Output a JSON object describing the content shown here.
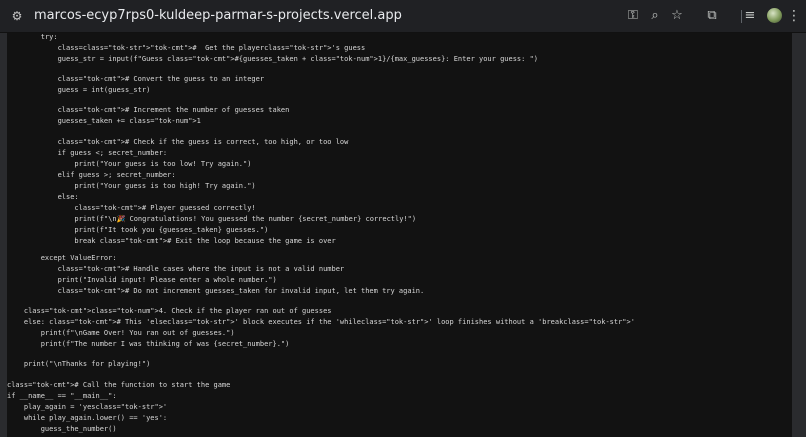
{
  "browser": {
    "url": "marcos-ecyp7rps0-kuldeep-parmar-s-projects.vercel.app",
    "icons": [
      "site-info-icon",
      "key-icon",
      "zoom-icon",
      "bookmark-star-icon",
      "cast-icon",
      "media-control-icon",
      "profile-avatar",
      "more-menu-icon"
    ]
  },
  "code_lines": [
    "        try:",
    "            class=class=\"tok-str\">\"tok-cmt\">#  Get the playerclass=\"tok-str\">'s guess",
    "            guess_str = input(f\"Guess class=\"tok-cmt\">#{guesses_taken + class=\"tok-num\">1}/{max_guesses}: Enter your guess: \")",
    "",
    "            class=\"tok-cmt\"># Convert the guess to an integer",
    "            guess = int(guess_str)",
    "",
    "            class=\"tok-cmt\"># Increment the number of guesses taken",
    "            guesses_taken += class=\"tok-num\">1",
    "",
    "            class=\"tok-cmt\"># Check if the guess is correct, too high, or too low",
    "            if guess <; secret_number:",
    "                print(\"Your guess is too low! Try again.\")",
    "            elif guess >; secret_number:",
    "                print(\"Your guess is too high! Try again.\")",
    "            else:",
    "                class=\"tok-cmt\"># Player guessed correctly!",
    "                print(f\"\\n🎉 Congratulations! You guessed the number {secret_number} correctly!\")",
    "                print(f\"It took you {guesses_taken} guesses.\")",
    "                break class=\"tok-cmt\"># Exit the loop because the game is over",
    "",
    "        except ValueError:",
    "            class=\"tok-cmt\"># Handle cases where the input is not a valid number",
    "            print(\"Invalid input! Please enter a whole number.\")",
    "            class=\"tok-cmt\"># Do not increment guesses_taken for invalid input, let them try again.",
    "",
    "    class=\"tok-cmt\">class=\"tok-num\">4. Check if the player ran out of guesses",
    "    else: class=\"tok-cmt\"># This 'elseclass=\"tok-str\">' block executes if the 'whileclass=\"tok-str\">' loop finishes without a 'breakclass=\"tok-str\">'",
    "        print(f\"\\nGame Over! You ran out of guesses.\")",
    "        print(f\"The number I was thinking of was {secret_number}.\")",
    "",
    "    print(\"\\nThanks for playing!\")",
    "",
    "class=\"tok-cmt\"># Call the function to start the game",
    "if __name__ == \"__main__\":",
    "    play_again = 'yesclass=\"tok-str\">'",
    "    while play_again.lower() == 'yes':",
    "        guess_the_number()"
  ]
}
